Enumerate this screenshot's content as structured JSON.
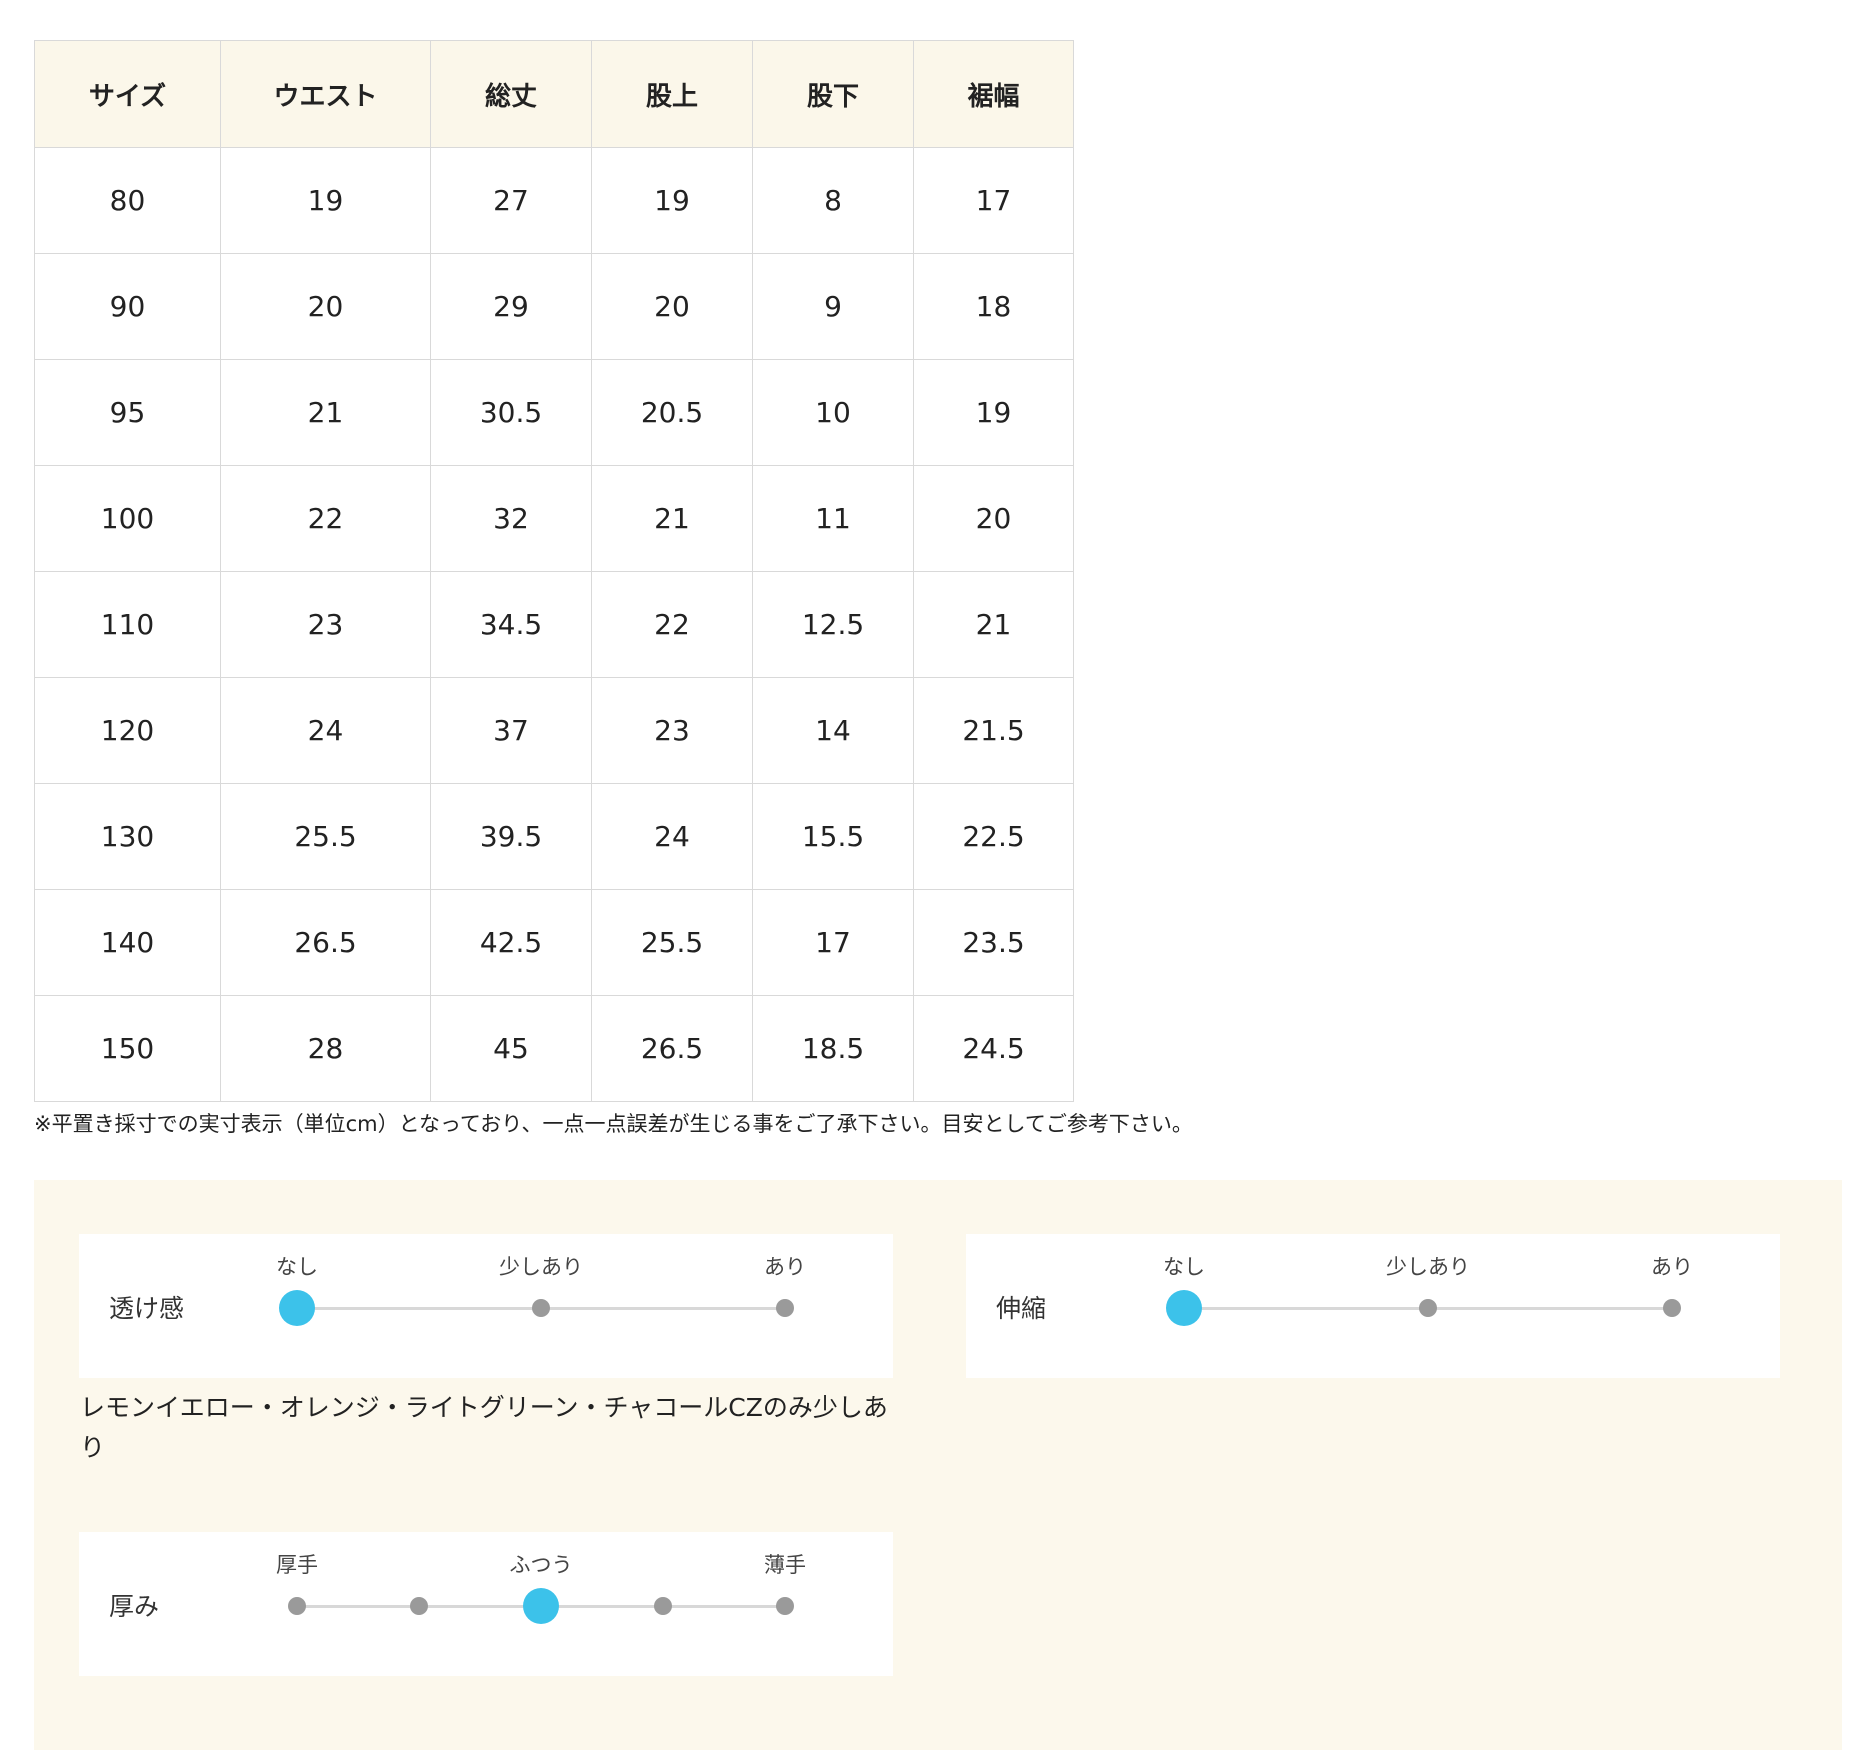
{
  "size_table": {
    "headers": [
      "サイズ",
      "ウエスト",
      "総丈",
      "股上",
      "股下",
      "裾幅"
    ],
    "rows": [
      [
        "80",
        "19",
        "27",
        "19",
        "8",
        "17"
      ],
      [
        "90",
        "20",
        "29",
        "20",
        "9",
        "18"
      ],
      [
        "95",
        "21",
        "30.5",
        "20.5",
        "10",
        "19"
      ],
      [
        "100",
        "22",
        "32",
        "21",
        "11",
        "20"
      ],
      [
        "110",
        "23",
        "34.5",
        "22",
        "12.5",
        "21"
      ],
      [
        "120",
        "24",
        "37",
        "23",
        "14",
        "21.5"
      ],
      [
        "130",
        "25.5",
        "39.5",
        "24",
        "15.5",
        "22.5"
      ],
      [
        "140",
        "26.5",
        "42.5",
        "25.5",
        "17",
        "23.5"
      ],
      [
        "150",
        "28",
        "45",
        "26.5",
        "18.5",
        "24.5"
      ]
    ],
    "note": "※平置き採寸での実寸表示（単位cm）となっており、一点一点誤差が生じる事をご了承下さい。目安としてご参考下さい。"
  },
  "fabric": {
    "transparency": {
      "label": "透け感",
      "ticks": [
        "なし",
        "少しあり",
        "あり"
      ],
      "steps": 3,
      "selected_index": 0,
      "note": "レモンイエロー・オレンジ・ライトグリーン・チャコールCZのみ少しあり"
    },
    "stretch": {
      "label": "伸縮",
      "ticks": [
        "なし",
        "少しあり",
        "あり"
      ],
      "steps": 3,
      "selected_index": 0
    },
    "thickness": {
      "label": "厚み",
      "ticks": [
        "厚手",
        "ふつう",
        "薄手"
      ],
      "steps": 5,
      "selected_index": 2
    }
  },
  "colors": {
    "header_bg": "#fbf7ea",
    "panel_bg": "#fcf8ec",
    "active_dot": "#3cc2ea",
    "inactive_dot": "#9a9a9a"
  }
}
